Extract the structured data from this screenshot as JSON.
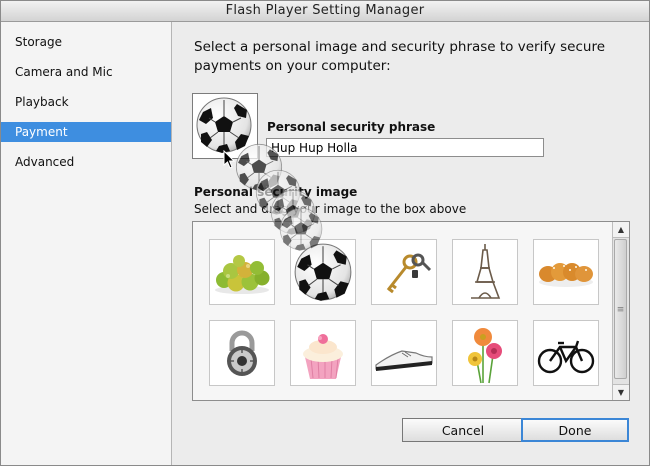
{
  "window": {
    "title": "Flash Player Setting Manager"
  },
  "sidebar": {
    "items": [
      {
        "label": "Storage",
        "selected": false
      },
      {
        "label": "Camera and Mic",
        "selected": false
      },
      {
        "label": "Playback",
        "selected": false
      },
      {
        "label": "Payment",
        "selected": true
      },
      {
        "label": "Advanced",
        "selected": false
      }
    ]
  },
  "payment": {
    "intro": "Select a personal image and security phrase to verify secure payments on your computer:",
    "selected_image": "soccer-ball",
    "phrase_label": "Personal security phrase",
    "phrase_value": "Hup Hup Holla",
    "image_label": "Personal security image",
    "image_hint": "Select and drag your image to the box above",
    "images": [
      "apples",
      "soccer-ball",
      "keys",
      "eiffel-tower",
      "bread",
      "padlock",
      "cupcake",
      "shoe",
      "flowers",
      "bicycle"
    ]
  },
  "buttons": {
    "cancel": "Cancel",
    "done": "Done"
  },
  "colors": {
    "selection": "#3e8ee0",
    "done_border": "#3b86d6"
  }
}
